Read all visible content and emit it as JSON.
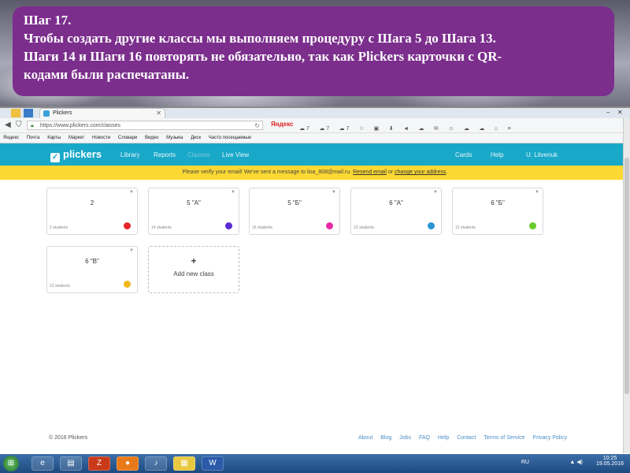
{
  "callout": {
    "line1": "Шаг 17.",
    "line2": "Чтобы создать другие классы мы выполняем процедуру с Шага 5 до Шага 13.",
    "line3": "Шаги 14 и Шаги 16 повторять не обязательно, так как Plickers карточки с QR-",
    "line4": "кодами были распечатаны."
  },
  "browser": {
    "tab_title": "Plickers",
    "url": "https://www.plickers.com/classes",
    "search_engine": "Яндекс",
    "ext_counts": [
      "7",
      "7",
      "7"
    ],
    "bookmarks": [
      "Яндекс",
      "Почта",
      "Карты",
      "Маркет",
      "Новости",
      "Словари",
      "Видео",
      "Музыка",
      "Диск",
      "Часто посещаемые"
    ]
  },
  "app": {
    "logo": "plickers",
    "nav": [
      "Library",
      "Reports",
      "Classes",
      "Live View"
    ],
    "nav_right": [
      "Cards",
      "Help",
      "U. Litvenuk"
    ],
    "notice_text": "Please verify your email! We've sent a message to lisa_808@mail.ru. ",
    "notice_resend": "Resend email",
    "notice_or": " or ",
    "notice_change": "change your address",
    "notice_end": "."
  },
  "classes": [
    {
      "name": "2",
      "students": "2 students",
      "color": "#e3262b"
    },
    {
      "name": "5 \"A\"",
      "students": "14 students",
      "color": "#5b2ad6"
    },
    {
      "name": "5 \"Б\"",
      "students": "16 students",
      "color": "#e82aa8"
    },
    {
      "name": "6 \"A\"",
      "students": "12 students",
      "color": "#2a94d6"
    },
    {
      "name": "6 \"Б\"",
      "students": "12 students",
      "color": "#66cc2a"
    },
    {
      "name": "6 \"В\"",
      "students": "12 students",
      "color": "#f0b81a"
    }
  ],
  "add_class": {
    "plus": "+",
    "label": "Add new class"
  },
  "footer": {
    "copyright": "© 2016 Plickers",
    "links": [
      "About",
      "Blog",
      "Jobs",
      "FAQ",
      "Help",
      "Contact",
      "Terms of Service",
      "Privacy Policy"
    ]
  },
  "taskbar": {
    "lang": "RU",
    "time": "10:25",
    "date": "19.05.2016"
  }
}
